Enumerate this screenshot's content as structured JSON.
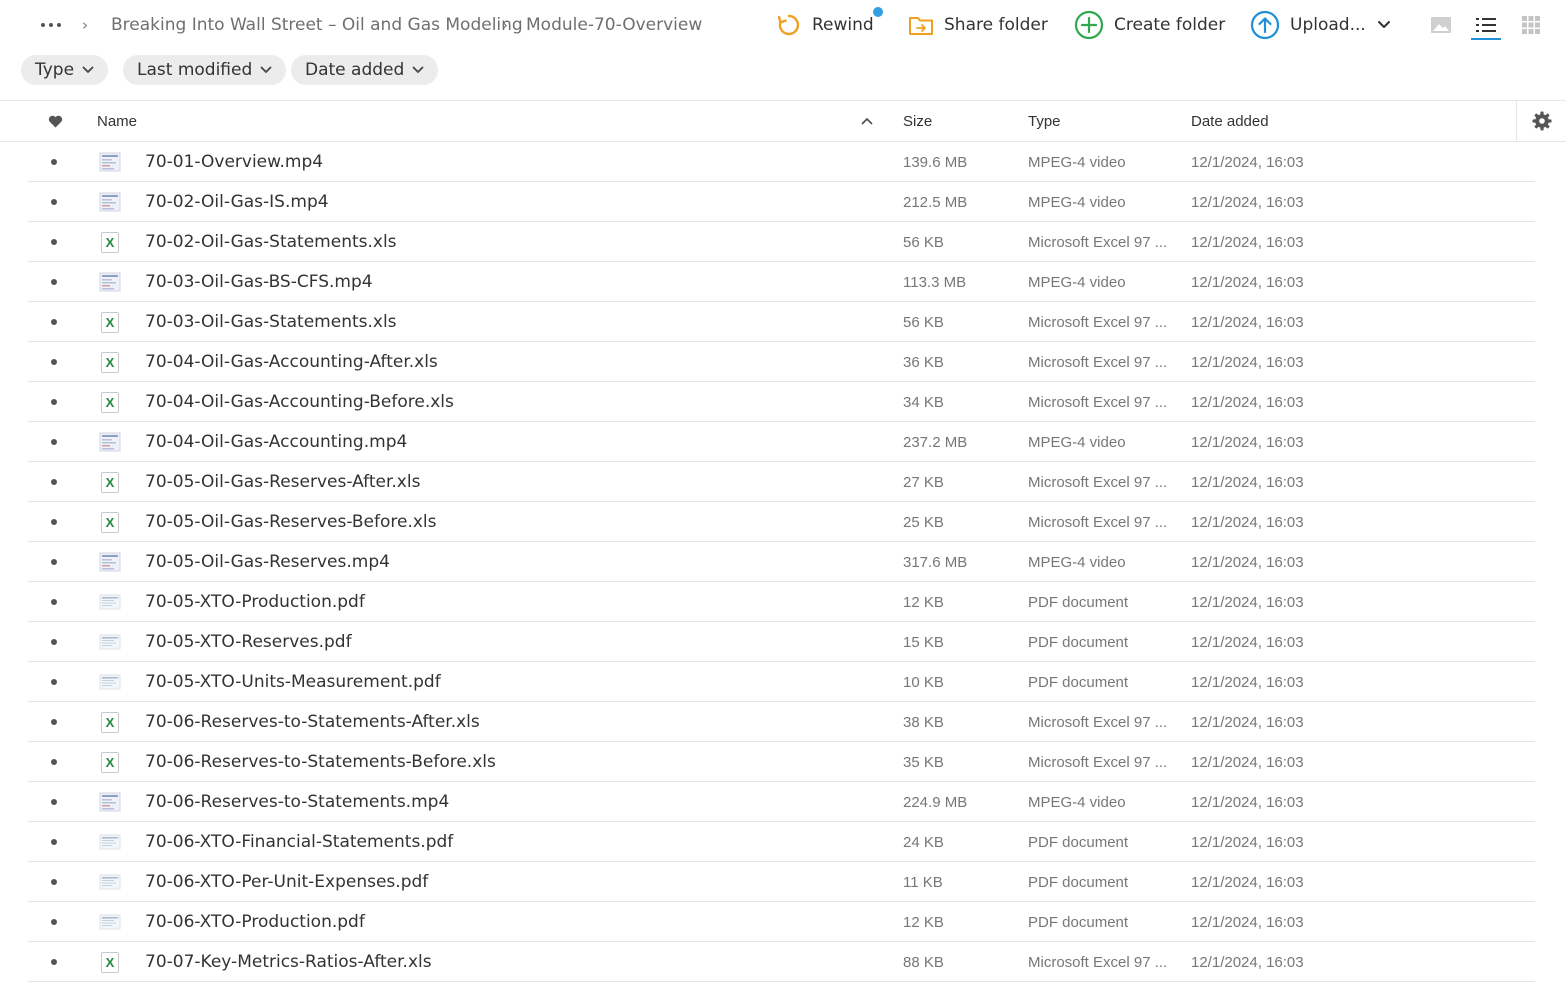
{
  "breadcrumb": {
    "items": [
      "Breaking Into Wall Street – Oil and Gas Modeling",
      "Module-70-Overview"
    ],
    "separator": "›"
  },
  "toolbar": {
    "rewind_label": "Rewind",
    "share_label": "Share folder",
    "create_label": "Create folder",
    "upload_label": "Upload..."
  },
  "filters": {
    "type_label": "Type",
    "last_modified_label": "Last modified",
    "date_added_label": "Date added"
  },
  "table": {
    "columns": {
      "name": "Name",
      "size": "Size",
      "type": "Type",
      "date_added": "Date added"
    },
    "rows": [
      {
        "name": "70-01-Overview.mp4",
        "size": "139.6 MB",
        "type": "MPEG-4 video",
        "date": "12/1/2024, 16:03",
        "kind": "video"
      },
      {
        "name": "70-02-Oil-Gas-IS.mp4",
        "size": "212.5 MB",
        "type": "MPEG-4 video",
        "date": "12/1/2024, 16:03",
        "kind": "video"
      },
      {
        "name": "70-02-Oil-Gas-Statements.xls",
        "size": "56 KB",
        "type": "Microsoft Excel 97 ...",
        "date": "12/1/2024, 16:03",
        "kind": "xls"
      },
      {
        "name": "70-03-Oil-Gas-BS-CFS.mp4",
        "size": "113.3 MB",
        "type": "MPEG-4 video",
        "date": "12/1/2024, 16:03",
        "kind": "video"
      },
      {
        "name": "70-03-Oil-Gas-Statements.xls",
        "size": "56 KB",
        "type": "Microsoft Excel 97 ...",
        "date": "12/1/2024, 16:03",
        "kind": "xls"
      },
      {
        "name": "70-04-Oil-Gas-Accounting-After.xls",
        "size": "36 KB",
        "type": "Microsoft Excel 97 ...",
        "date": "12/1/2024, 16:03",
        "kind": "xls"
      },
      {
        "name": "70-04-Oil-Gas-Accounting-Before.xls",
        "size": "34 KB",
        "type": "Microsoft Excel 97 ...",
        "date": "12/1/2024, 16:03",
        "kind": "xls"
      },
      {
        "name": "70-04-Oil-Gas-Accounting.mp4",
        "size": "237.2 MB",
        "type": "MPEG-4 video",
        "date": "12/1/2024, 16:03",
        "kind": "video"
      },
      {
        "name": "70-05-Oil-Gas-Reserves-After.xls",
        "size": "27 KB",
        "type": "Microsoft Excel 97 ...",
        "date": "12/1/2024, 16:03",
        "kind": "xls"
      },
      {
        "name": "70-05-Oil-Gas-Reserves-Before.xls",
        "size": "25 KB",
        "type": "Microsoft Excel 97 ...",
        "date": "12/1/2024, 16:03",
        "kind": "xls"
      },
      {
        "name": "70-05-Oil-Gas-Reserves.mp4",
        "size": "317.6 MB",
        "type": "MPEG-4 video",
        "date": "12/1/2024, 16:03",
        "kind": "video"
      },
      {
        "name": "70-05-XTO-Production.pdf",
        "size": "12 KB",
        "type": "PDF document",
        "date": "12/1/2024, 16:03",
        "kind": "pdf"
      },
      {
        "name": "70-05-XTO-Reserves.pdf",
        "size": "15 KB",
        "type": "PDF document",
        "date": "12/1/2024, 16:03",
        "kind": "pdf"
      },
      {
        "name": "70-05-XTO-Units-Measurement.pdf",
        "size": "10 KB",
        "type": "PDF document",
        "date": "12/1/2024, 16:03",
        "kind": "pdf"
      },
      {
        "name": "70-06-Reserves-to-Statements-After.xls",
        "size": "38 KB",
        "type": "Microsoft Excel 97 ...",
        "date": "12/1/2024, 16:03",
        "kind": "xls"
      },
      {
        "name": "70-06-Reserves-to-Statements-Before.xls",
        "size": "35 KB",
        "type": "Microsoft Excel 97 ...",
        "date": "12/1/2024, 16:03",
        "kind": "xls"
      },
      {
        "name": "70-06-Reserves-to-Statements.mp4",
        "size": "224.9 MB",
        "type": "MPEG-4 video",
        "date": "12/1/2024, 16:03",
        "kind": "video"
      },
      {
        "name": "70-06-XTO-Financial-Statements.pdf",
        "size": "24 KB",
        "type": "PDF document",
        "date": "12/1/2024, 16:03",
        "kind": "pdf"
      },
      {
        "name": "70-06-XTO-Per-Unit-Expenses.pdf",
        "size": "11 KB",
        "type": "PDF document",
        "date": "12/1/2024, 16:03",
        "kind": "pdf"
      },
      {
        "name": "70-06-XTO-Production.pdf",
        "size": "12 KB",
        "type": "PDF document",
        "date": "12/1/2024, 16:03",
        "kind": "pdf"
      },
      {
        "name": "70-07-Key-Metrics-Ratios-After.xls",
        "size": "88 KB",
        "type": "Microsoft Excel 97 ...",
        "date": "12/1/2024, 16:03",
        "kind": "xls"
      }
    ]
  },
  "colors": {
    "rewind": "#f0a020",
    "share": "#f0a020",
    "create": "#2fa84f",
    "upload": "#1f8fd8",
    "badge": "#30a0e0",
    "excel": "#1e8a3c"
  }
}
